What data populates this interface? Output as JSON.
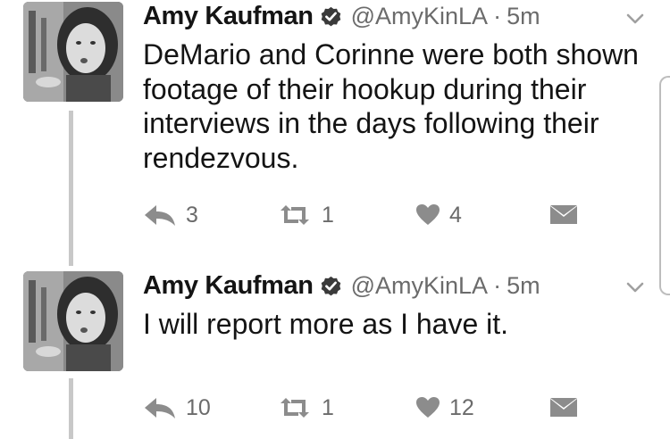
{
  "tweets": [
    {
      "author": {
        "name": "Amy Kaufman",
        "handle": "@AmyKinLA",
        "verified": true
      },
      "separator": "·",
      "time": "5m",
      "text": "DeMario and Corinne were both shown footage of their hookup during their interviews in the days following their rendezvous.",
      "replies": "3",
      "retweets": "1",
      "likes": "4"
    },
    {
      "author": {
        "name": "Amy Kaufman",
        "handle": "@AmyKinLA",
        "verified": true
      },
      "separator": "·",
      "time": "5m",
      "text": "I will report more as I have it.",
      "replies": "10",
      "retweets": "1",
      "likes": "12"
    }
  ],
  "icons": {
    "verified": "verified-badge-icon",
    "menu": "chevron-down-icon",
    "reply": "reply-icon",
    "retweet": "retweet-icon",
    "like": "heart-icon",
    "message": "envelope-icon"
  },
  "colors": {
    "text": "#141414",
    "secondary": "#6b6b6b",
    "thread_line": "#c8c8c8",
    "icon": "#8c8c8c"
  }
}
